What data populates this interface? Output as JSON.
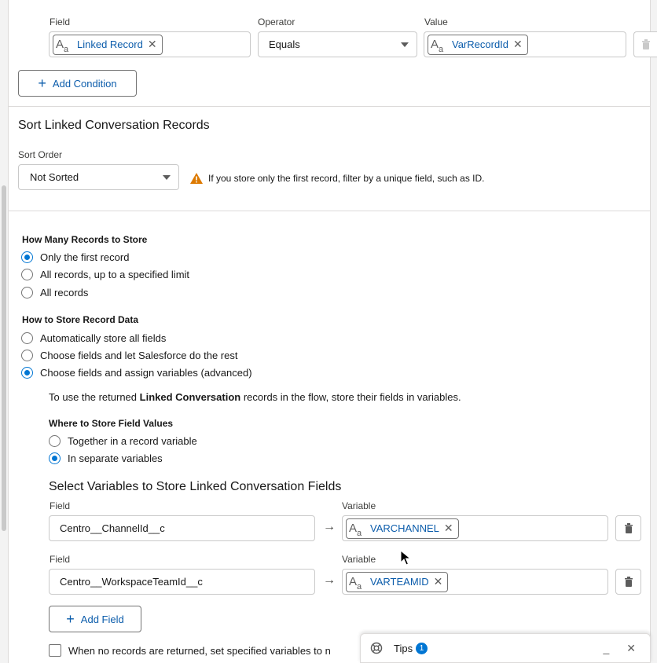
{
  "condition": {
    "field_label": "Field",
    "operator_label": "Operator",
    "value_label": "Value",
    "field_value": "Linked Record",
    "operator_value": "Equals",
    "value_value": "VarRecordId",
    "add_condition_label": "Add Condition"
  },
  "sort": {
    "heading": "Sort Linked Conversation Records",
    "order_label": "Sort Order",
    "order_value": "Not Sorted",
    "warning": "If you store only the first record, filter by a unique field, such as ID."
  },
  "store_count": {
    "heading": "How Many Records to Store",
    "options": [
      "Only the first record",
      "All records, up to a specified limit",
      "All records"
    ],
    "selected": 0
  },
  "store_data": {
    "heading": "How to Store Record Data",
    "options": [
      "Automatically store all fields",
      "Choose fields and let Salesforce do the rest",
      "Choose fields and assign variables (advanced)"
    ],
    "selected": 2
  },
  "info": {
    "pre": "To use the returned ",
    "bold": "Linked Conversation",
    "post": " records in the flow, store their fields in variables."
  },
  "where_store": {
    "heading": "Where to Store Field Values",
    "options": [
      "Together in a record variable",
      "In separate variables"
    ],
    "selected": 1
  },
  "select_vars": {
    "heading": "Select Variables to Store Linked Conversation Fields",
    "field_label": "Field",
    "variable_label": "Variable",
    "rows": [
      {
        "field": "Centro__ChannelId__c",
        "variable": "VARCHANNEL"
      },
      {
        "field": "Centro__WorkspaceTeamId__c",
        "variable": "VARTEAMID"
      }
    ],
    "add_field_label": "Add Field"
  },
  "no_records": {
    "label": "When no records are returned, set specified variables to n"
  },
  "tips": {
    "label": "Tips",
    "count": "1"
  },
  "colors": {
    "accent": "#0176d3",
    "link": "#0b5cab",
    "warning": "#dd7a01"
  }
}
